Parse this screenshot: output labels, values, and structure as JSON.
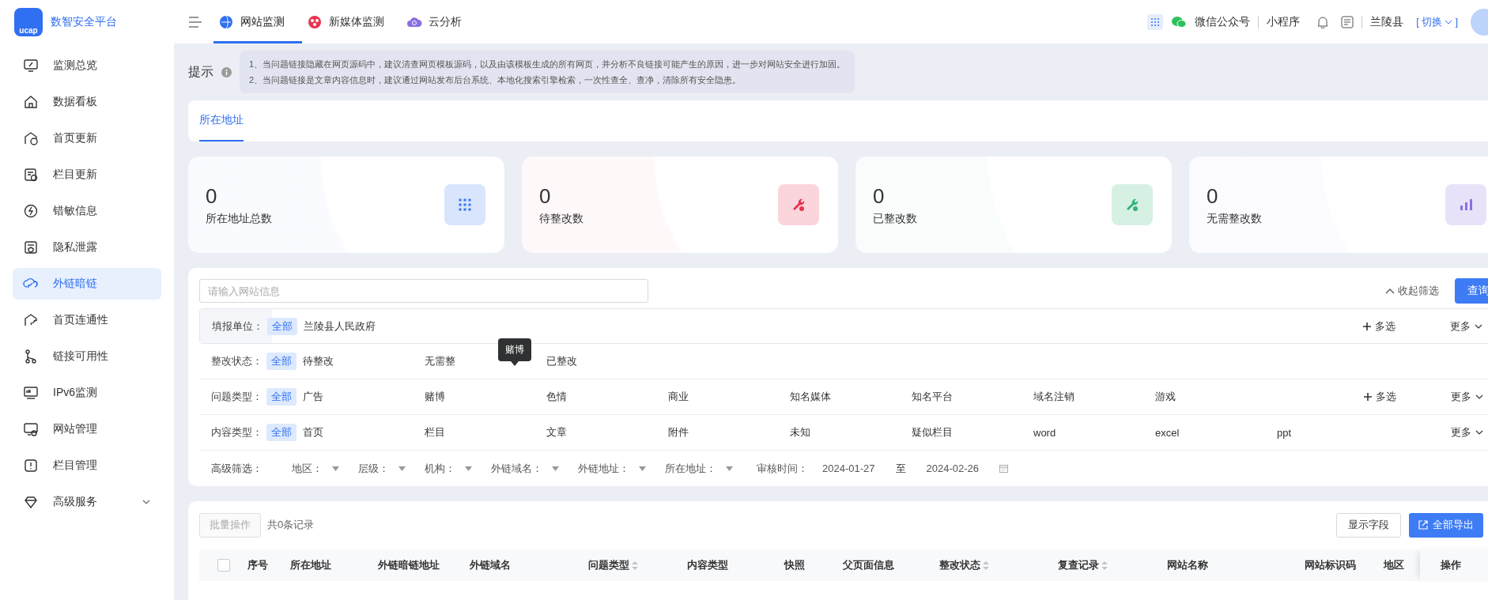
{
  "app": {
    "logo_text": "ucap",
    "title": "数智安全平台"
  },
  "top_nav": [
    {
      "label": "网站监测",
      "selected": true
    },
    {
      "label": "新媒体监测",
      "selected": false
    },
    {
      "label": "云分析",
      "selected": false
    }
  ],
  "header": {
    "links": [
      "微信公众号",
      "小程序"
    ],
    "region": "兰陵县",
    "switch": "切换",
    "bracket_open": "[",
    "bracket_close": "]"
  },
  "sidebar": {
    "items": [
      {
        "label": "监测总览",
        "selected": false,
        "has_submenu": false
      },
      {
        "label": "数据看板",
        "selected": false,
        "has_submenu": false
      },
      {
        "label": "首页更新",
        "selected": false,
        "has_submenu": false
      },
      {
        "label": "栏目更新",
        "selected": false,
        "has_submenu": false
      },
      {
        "label": "错敏信息",
        "selected": false,
        "has_submenu": false
      },
      {
        "label": "隐私泄露",
        "selected": false,
        "has_submenu": false
      },
      {
        "label": "外链暗链",
        "selected": true,
        "has_submenu": false
      },
      {
        "label": "首页连通性",
        "selected": false,
        "has_submenu": false
      },
      {
        "label": "链接可用性",
        "selected": false,
        "has_submenu": false
      },
      {
        "label": "IPv6监测",
        "selected": false,
        "has_submenu": false
      },
      {
        "label": "网站管理",
        "selected": false,
        "has_submenu": false
      },
      {
        "label": "栏目管理",
        "selected": false,
        "has_submenu": false
      },
      {
        "label": "高级服务",
        "selected": false,
        "has_submenu": true
      }
    ]
  },
  "hint": {
    "label": "提示",
    "lines": [
      "1、当问题链接隐藏在网页源码中，建议清查网页模板源码，以及由该模板生成的所有网页，并分析不良链接可能产生的原因，进一步对网站安全进行加固。",
      "2、当问题链接是文章内容信息时，建议通过网站发布后台系统、本地化搜索引擎检索，一次性查全、查净，清除所有安全隐患。"
    ]
  },
  "tabs": [
    {
      "label": "所在地址",
      "selected": true
    }
  ],
  "stats": [
    {
      "value": "0",
      "label": "所在地址总数",
      "color": "#3d7cf5"
    },
    {
      "value": "0",
      "label": "待整改数",
      "color": "#e8344e"
    },
    {
      "value": "0",
      "label": "已整改数",
      "color": "#34b27a"
    },
    {
      "value": "0",
      "label": "无需整改数",
      "color": "#8a6fe0"
    }
  ],
  "filters": {
    "search": {
      "placeholder": "请输入网站信息"
    },
    "collapse": "收起筛选",
    "query": "查询",
    "rows": [
      {
        "label": "填报单位：",
        "highlighted": true,
        "multi": "多选",
        "more": "更多",
        "options": [
          {
            "label": "全部",
            "selected": true
          },
          {
            "label": "兰陵县人民政府",
            "selected": false
          }
        ]
      },
      {
        "label": "整改状态：",
        "highlighted": false,
        "options": [
          {
            "label": "全部",
            "selected": true
          },
          {
            "label": "待整改",
            "selected": false
          },
          {
            "label": "无需整",
            "selected": false
          },
          {
            "label": "已整改",
            "selected": false
          }
        ]
      },
      {
        "label": "问题类型：",
        "highlighted": false,
        "multi": "多选",
        "more": "更多",
        "options": [
          {
            "label": "全部",
            "selected": true
          },
          {
            "label": "广告",
            "selected": false
          },
          {
            "label": "赌博",
            "selected": false
          },
          {
            "label": "色情",
            "selected": false
          },
          {
            "label": "商业",
            "selected": false
          },
          {
            "label": "知名媒体",
            "selected": false
          },
          {
            "label": "知名平台",
            "selected": false
          },
          {
            "label": "域名注销",
            "selected": false
          },
          {
            "label": "游戏",
            "selected": false
          }
        ]
      },
      {
        "label": "内容类型：",
        "highlighted": false,
        "more": "更多",
        "options": [
          {
            "label": "全部",
            "selected": true
          },
          {
            "label": "首页",
            "selected": false
          },
          {
            "label": "栏目",
            "selected": false
          },
          {
            "label": "文章",
            "selected": false
          },
          {
            "label": "附件",
            "selected": false
          },
          {
            "label": "未知",
            "selected": false
          },
          {
            "label": "疑似栏目",
            "selected": false
          },
          {
            "label": "word",
            "selected": false
          },
          {
            "label": "excel",
            "selected": false
          },
          {
            "label": "ppt",
            "selected": false
          }
        ]
      }
    ],
    "tooltip": "赌博",
    "advanced": {
      "label": "高级筛选：",
      "dropdowns": [
        "地区：",
        "层级：",
        "机构：",
        "外链域名：",
        "外链地址：",
        "所在地址："
      ],
      "date_label": "审核时间：",
      "start": "2024-01-27",
      "separator": "至",
      "end": "2024-02-26"
    }
  },
  "table": {
    "select_all_checked": false,
    "batch": "批量操作",
    "count": "共0条记录",
    "show_fields": "显示字段",
    "export": "全部导出",
    "columns": [
      {
        "label": "序号",
        "sortable": false
      },
      {
        "label": "所在地址",
        "sortable": false
      },
      {
        "label": "外链暗链地址",
        "sortable": false
      },
      {
        "label": "外链域名",
        "sortable": false
      },
      {
        "label": "问题类型",
        "sortable": true
      },
      {
        "label": "内容类型",
        "sortable": false
      },
      {
        "label": "快照",
        "sortable": false
      },
      {
        "label": "父页面信息",
        "sortable": false
      },
      {
        "label": "整改状态",
        "sortable": true
      },
      {
        "label": "复查记录",
        "sortable": true
      },
      {
        "label": "网站名称",
        "sortable": false
      },
      {
        "label": "网站标识码",
        "sortable": false
      },
      {
        "label": "地区",
        "sortable": false
      },
      {
        "label": "操作",
        "sortable": false
      }
    ]
  }
}
